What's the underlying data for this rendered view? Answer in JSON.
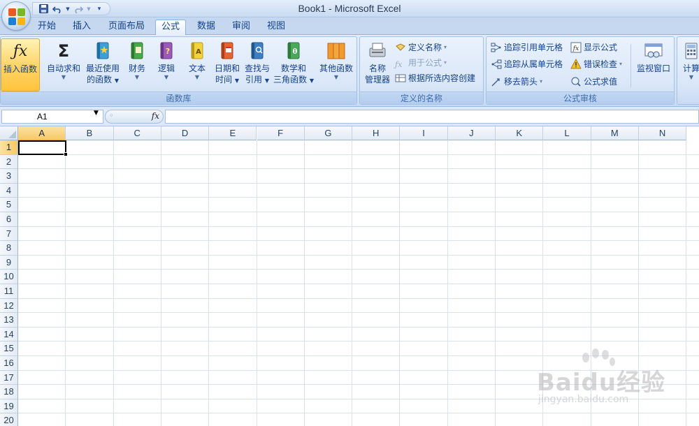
{
  "window": {
    "title": "Book1 - Microsoft Excel"
  },
  "quick_access": {
    "items": [
      "save-icon",
      "undo-icon",
      "redo-icon",
      "customize-icon"
    ]
  },
  "tabs": [
    {
      "label": "开始"
    },
    {
      "label": "插入"
    },
    {
      "label": "页面布局"
    },
    {
      "label": "公式",
      "active": true
    },
    {
      "label": "数据"
    },
    {
      "label": "审阅"
    },
    {
      "label": "视图"
    }
  ],
  "ribbon": {
    "function_library": {
      "label": "函数库",
      "insert_function": {
        "line1": "插入函数",
        "icon": "fx-icon"
      },
      "autosum": {
        "line1": "自动求和",
        "icon": "sigma-icon"
      },
      "recent": {
        "line1": "最近使用",
        "line2": "的函数"
      },
      "financial": {
        "line1": "财务"
      },
      "logical": {
        "line1": "逻辑"
      },
      "text": {
        "line1": "文本"
      },
      "datetime": {
        "line1": "日期和",
        "line2": "时间"
      },
      "lookup": {
        "line1": "查找与",
        "line2": "引用"
      },
      "math": {
        "line1": "数学和",
        "line2": "三角函数"
      },
      "more": {
        "line1": "其他函数"
      }
    },
    "defined_names": {
      "label": "定义的名称",
      "name_manager": {
        "line1": "名称",
        "line2": "管理器"
      },
      "define_name": "定义名称",
      "use_in_formula": "用于公式",
      "create_from_selection": "根据所选内容创建"
    },
    "formula_auditing": {
      "label": "公式审核",
      "trace_precedents": "追踪引用单元格",
      "trace_dependents": "追踪从属单元格",
      "remove_arrows": "移去箭头",
      "show_formulas": "显示公式",
      "error_checking": "错误检查",
      "evaluate_formula": "公式求值",
      "watch_window": "监视窗口"
    },
    "calculation": {
      "calc_label": "计算"
    }
  },
  "formula_bar": {
    "name_box": "A1",
    "fx": "fx",
    "value": ""
  },
  "grid": {
    "columns": [
      "A",
      "B",
      "C",
      "D",
      "E",
      "F",
      "G",
      "H",
      "I",
      "J",
      "K",
      "L",
      "M",
      "N"
    ],
    "rows": [
      "1",
      "2",
      "3",
      "4",
      "5",
      "6",
      "7",
      "8",
      "9",
      "10",
      "11",
      "12",
      "13",
      "14",
      "15",
      "16",
      "17",
      "18",
      "19",
      "20"
    ],
    "active_cell": "A1"
  },
  "watermark": {
    "brand": "Baidu经验",
    "url": "jingyan.baidu.com"
  },
  "colors": {
    "accent": "#15428b",
    "ribbon": "#dae7f8",
    "highlight": "#ffd56a"
  }
}
